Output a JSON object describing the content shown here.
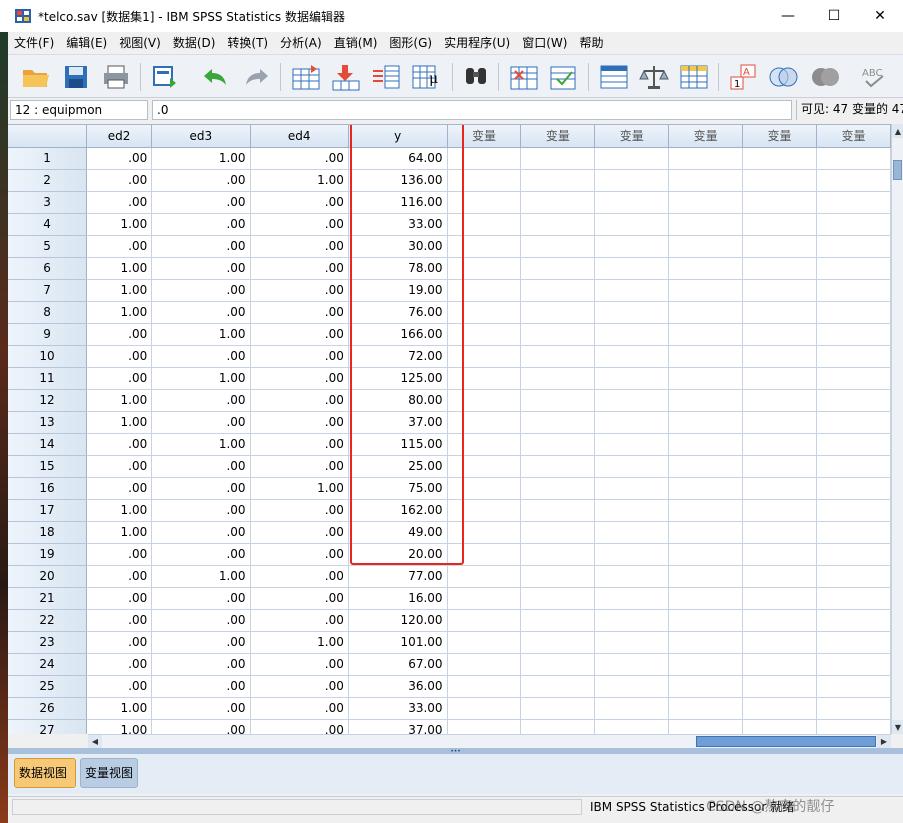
{
  "window": {
    "title": "*telco.sav [数据集1] - IBM SPSS Statistics 数据编辑器",
    "minimize": "—",
    "maximize": "☐",
    "close": "✕"
  },
  "menu": [
    "文件(F)",
    "编辑(E)",
    "视图(V)",
    "数据(D)",
    "转换(T)",
    "分析(A)",
    "直销(M)",
    "图形(G)",
    "实用程序(U)",
    "窗口(W)",
    "帮助"
  ],
  "toolbar_icons": [
    "open-folder-icon",
    "save-icon",
    "print-icon",
    "dialog-recall-icon",
    "undo-icon",
    "redo-icon",
    "goto-case-icon",
    "goto-variable-icon",
    "variables-icon",
    "run-descriptives-icon",
    "find-icon",
    "insert-cases-icon",
    "insert-variable-icon",
    "split-file-icon",
    "weight-cases-icon",
    "select-cases-icon",
    "value-labels-icon",
    "use-variable-sets-icon",
    "show-all-variables-icon",
    "spell-check-icon"
  ],
  "editor": {
    "cell_ref": "12 : equipmon",
    "cell_value": ".0",
    "visible_count": "可见: 47 变量的 47"
  },
  "grid": {
    "columns": [
      "ed2",
      "ed3",
      "ed4",
      "y",
      "变量",
      "变量",
      "变量",
      "变量",
      "变量",
      "变量"
    ],
    "rows": [
      {
        "n": "1",
        "ed2": ".00",
        "ed3": "1.00",
        "ed4": ".00",
        "y": "64.00"
      },
      {
        "n": "2",
        "ed2": ".00",
        "ed3": ".00",
        "ed4": "1.00",
        "y": "136.00"
      },
      {
        "n": "3",
        "ed2": ".00",
        "ed3": ".00",
        "ed4": ".00",
        "y": "116.00"
      },
      {
        "n": "4",
        "ed2": "1.00",
        "ed3": ".00",
        "ed4": ".00",
        "y": "33.00"
      },
      {
        "n": "5",
        "ed2": ".00",
        "ed3": ".00",
        "ed4": ".00",
        "y": "30.00"
      },
      {
        "n": "6",
        "ed2": "1.00",
        "ed3": ".00",
        "ed4": ".00",
        "y": "78.00"
      },
      {
        "n": "7",
        "ed2": "1.00",
        "ed3": ".00",
        "ed4": ".00",
        "y": "19.00"
      },
      {
        "n": "8",
        "ed2": "1.00",
        "ed3": ".00",
        "ed4": ".00",
        "y": "76.00"
      },
      {
        "n": "9",
        "ed2": ".00",
        "ed3": "1.00",
        "ed4": ".00",
        "y": "166.00"
      },
      {
        "n": "10",
        "ed2": ".00",
        "ed3": ".00",
        "ed4": ".00",
        "y": "72.00"
      },
      {
        "n": "11",
        "ed2": ".00",
        "ed3": "1.00",
        "ed4": ".00",
        "y": "125.00"
      },
      {
        "n": "12",
        "ed2": "1.00",
        "ed3": ".00",
        "ed4": ".00",
        "y": "80.00"
      },
      {
        "n": "13",
        "ed2": "1.00",
        "ed3": ".00",
        "ed4": ".00",
        "y": "37.00"
      },
      {
        "n": "14",
        "ed2": ".00",
        "ed3": "1.00",
        "ed4": ".00",
        "y": "115.00"
      },
      {
        "n": "15",
        "ed2": ".00",
        "ed3": ".00",
        "ed4": ".00",
        "y": "25.00"
      },
      {
        "n": "16",
        "ed2": ".00",
        "ed3": ".00",
        "ed4": "1.00",
        "y": "75.00"
      },
      {
        "n": "17",
        "ed2": "1.00",
        "ed3": ".00",
        "ed4": ".00",
        "y": "162.00"
      },
      {
        "n": "18",
        "ed2": "1.00",
        "ed3": ".00",
        "ed4": ".00",
        "y": "49.00"
      },
      {
        "n": "19",
        "ed2": ".00",
        "ed3": ".00",
        "ed4": ".00",
        "y": "20.00"
      },
      {
        "n": "20",
        "ed2": ".00",
        "ed3": "1.00",
        "ed4": ".00",
        "y": "77.00"
      },
      {
        "n": "21",
        "ed2": ".00",
        "ed3": ".00",
        "ed4": ".00",
        "y": "16.00"
      },
      {
        "n": "22",
        "ed2": ".00",
        "ed3": ".00",
        "ed4": ".00",
        "y": "120.00"
      },
      {
        "n": "23",
        "ed2": ".00",
        "ed3": ".00",
        "ed4": "1.00",
        "y": "101.00"
      },
      {
        "n": "24",
        "ed2": ".00",
        "ed3": ".00",
        "ed4": ".00",
        "y": "67.00"
      },
      {
        "n": "25",
        "ed2": ".00",
        "ed3": ".00",
        "ed4": ".00",
        "y": "36.00"
      },
      {
        "n": "26",
        "ed2": "1.00",
        "ed3": ".00",
        "ed4": ".00",
        "y": "33.00"
      },
      {
        "n": "27",
        "ed2": "1.00",
        "ed3": ".00",
        "ed4": ".00",
        "y": "37.00"
      }
    ]
  },
  "tabs": {
    "data_view": "数据视图",
    "variable_view": "变量视图"
  },
  "status": {
    "text": "IBM SPSS Statistics Processor 就绪",
    "watermark": "CSDN @熬夜的靓仔"
  },
  "colors": {
    "highlight": "#e8261f",
    "active_tab": "#f7c977",
    "header": "#d7e4f2"
  }
}
